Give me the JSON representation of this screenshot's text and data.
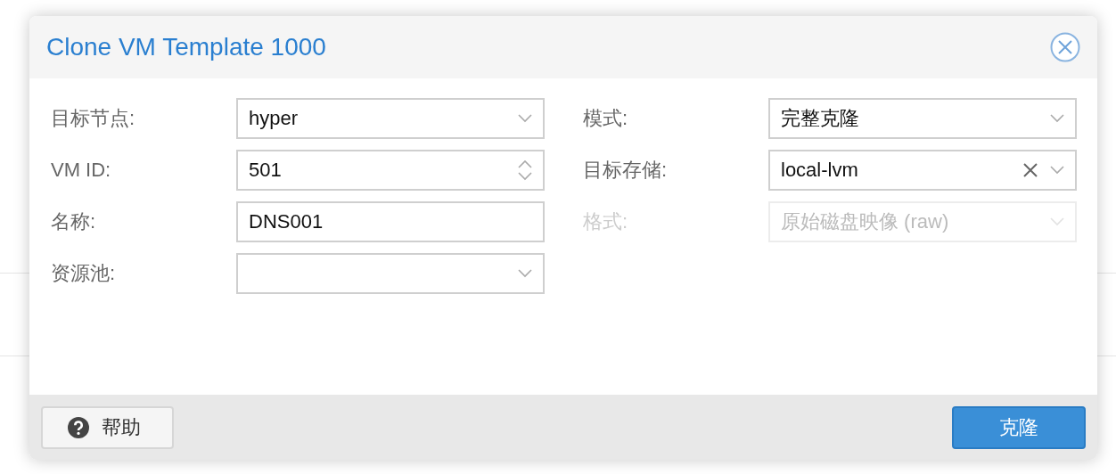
{
  "dialog": {
    "title": "Clone VM Template 1000"
  },
  "left_fields": [
    {
      "label": "目标节点:",
      "kind": "combo",
      "value": "hyper",
      "disabled": false,
      "clearable": false
    },
    {
      "label": "VM ID:",
      "kind": "spinner",
      "value": "501",
      "disabled": false
    },
    {
      "label": "名称:",
      "kind": "text",
      "value": "DNS001",
      "disabled": false
    },
    {
      "label": "资源池:",
      "kind": "combo",
      "disabled": false,
      "clearable": false
    }
  ],
  "right_fields": [
    {
      "label": "模式:",
      "kind": "combo",
      "value": "完整克隆",
      "disabled": false,
      "clearable": false
    },
    {
      "label": "目标存储:",
      "kind": "combo",
      "value": "local-lvm",
      "disabled": false,
      "clearable": true
    },
    {
      "label": "格式:",
      "kind": "combo",
      "value": "原始磁盘映像 (raw)",
      "disabled": true,
      "clearable": false
    }
  ],
  "footer": {
    "help_button": "帮助",
    "clone_button": "克隆"
  }
}
